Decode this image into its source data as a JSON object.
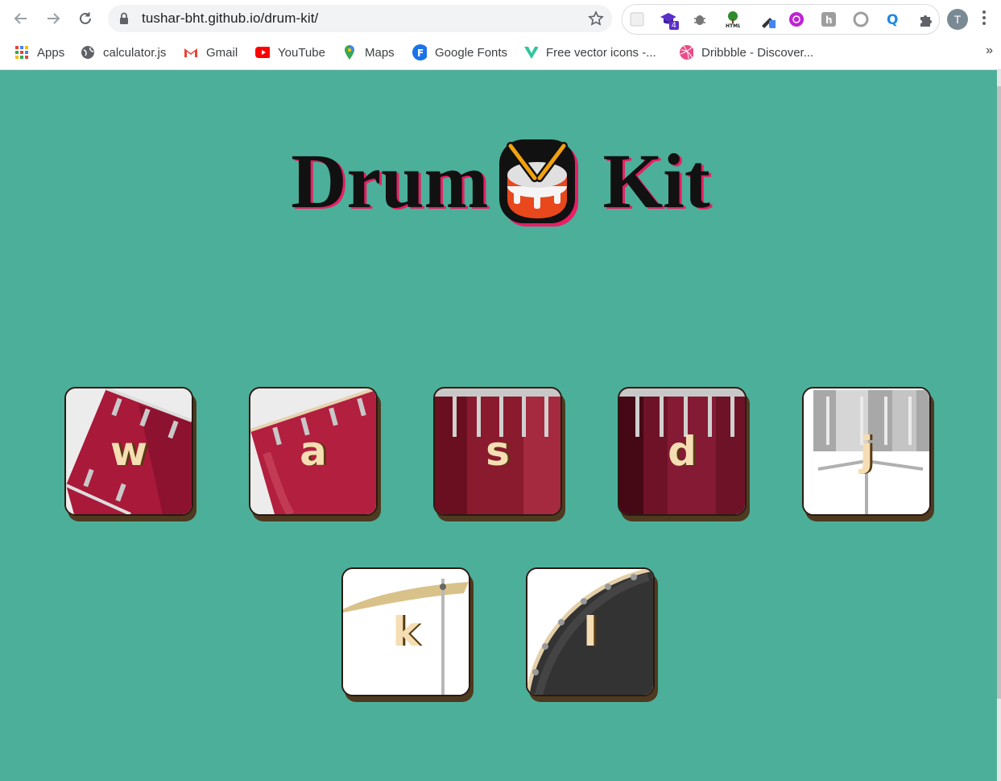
{
  "browser": {
    "url": "tushar-bht.github.io/drum-kit/",
    "avatar_initial": "T",
    "extension_badge": "4",
    "bookmarks": [
      {
        "label": "Apps",
        "icon": "apps-grid-icon"
      },
      {
        "label": "calculator.js",
        "icon": "globe-icon"
      },
      {
        "label": "Gmail",
        "icon": "gmail-icon"
      },
      {
        "label": "YouTube",
        "icon": "youtube-icon"
      },
      {
        "label": "Maps",
        "icon": "maps-icon"
      },
      {
        "label": "Google Fonts",
        "icon": "google-fonts-icon"
      },
      {
        "label": "Free vector icons -...",
        "icon": "vector-icons-icon"
      },
      {
        "label": "Dribbble - Discover...",
        "icon": "dribbble-icon"
      }
    ],
    "more_label": "»"
  },
  "page": {
    "title_left": "Drum",
    "title_right": "Kit",
    "title_shadow_color": "#e91e63",
    "background_color": "#4caf9a",
    "drums": [
      {
        "key": "w",
        "image": "tom-1"
      },
      {
        "key": "a",
        "image": "tom-2"
      },
      {
        "key": "s",
        "image": "tom-3"
      },
      {
        "key": "d",
        "image": "tom-4"
      },
      {
        "key": "j",
        "image": "snare"
      },
      {
        "key": "k",
        "image": "crash"
      },
      {
        "key": "l",
        "image": "kick"
      }
    ]
  }
}
